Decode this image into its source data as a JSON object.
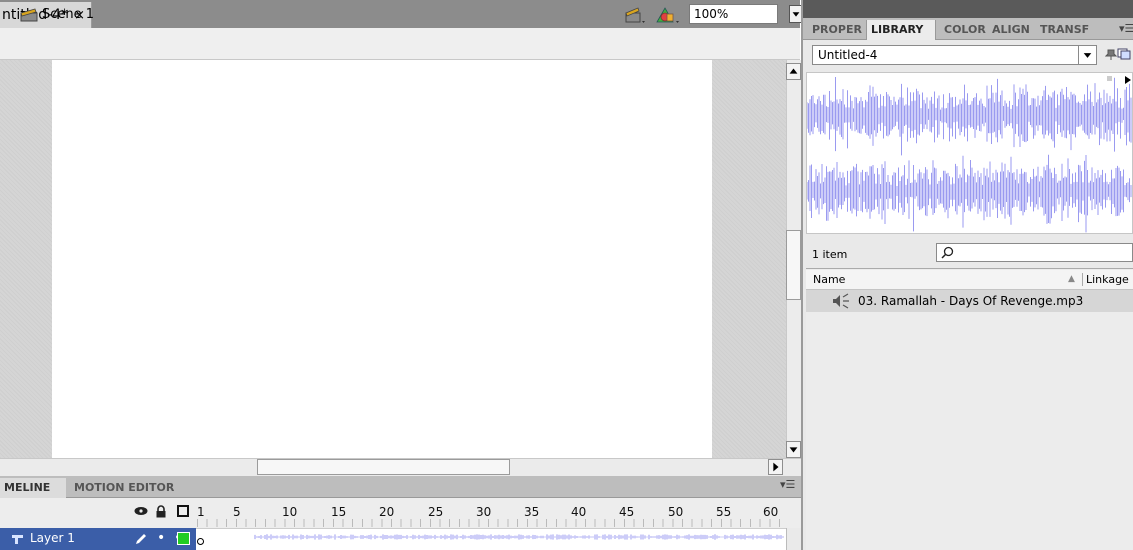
{
  "document": {
    "tab_title": "ntitled-4*",
    "close_glyph": "×"
  },
  "scene_bar": {
    "scene_label": "Scene 1",
    "zoom_value": "100%"
  },
  "timeline": {
    "tabs": [
      "MELINE",
      "MOTION EDITOR"
    ],
    "frame_numbers": [
      "1",
      "5",
      "10",
      "15",
      "20",
      "25",
      "30",
      "35",
      "40",
      "45",
      "50",
      "55",
      "60"
    ],
    "layer_name": "Layer 1",
    "options_glyph": "▾☰"
  },
  "panel": {
    "tabs": [
      "PROPER",
      "LIBRARY",
      "COLOR",
      "ALIGN",
      "TRANSF"
    ],
    "active_tab": "LIBRARY",
    "options_glyph": "▾☰"
  },
  "library": {
    "document_select": "Untitled-4",
    "item_count": "1 item",
    "search_value": "",
    "columns": {
      "name": "Name",
      "linkage": "Linkage"
    },
    "items": [
      {
        "name": "03. Ramallah - Days Of Revenge.mp3",
        "type": "sound"
      }
    ]
  },
  "colors": {
    "stage": "#ffffff",
    "waveform": "#9a9af0",
    "layer_selected": "#3b5ea8",
    "keyframe_fill": "#22cc22"
  },
  "icons": [
    "scene-icon",
    "edit-scene-icon",
    "edit-symbol-icon",
    "eye-icon",
    "lock-icon",
    "outline-icon",
    "pencil-icon",
    "sound-icon",
    "search-icon",
    "pin-icon",
    "new-library-icon"
  ]
}
